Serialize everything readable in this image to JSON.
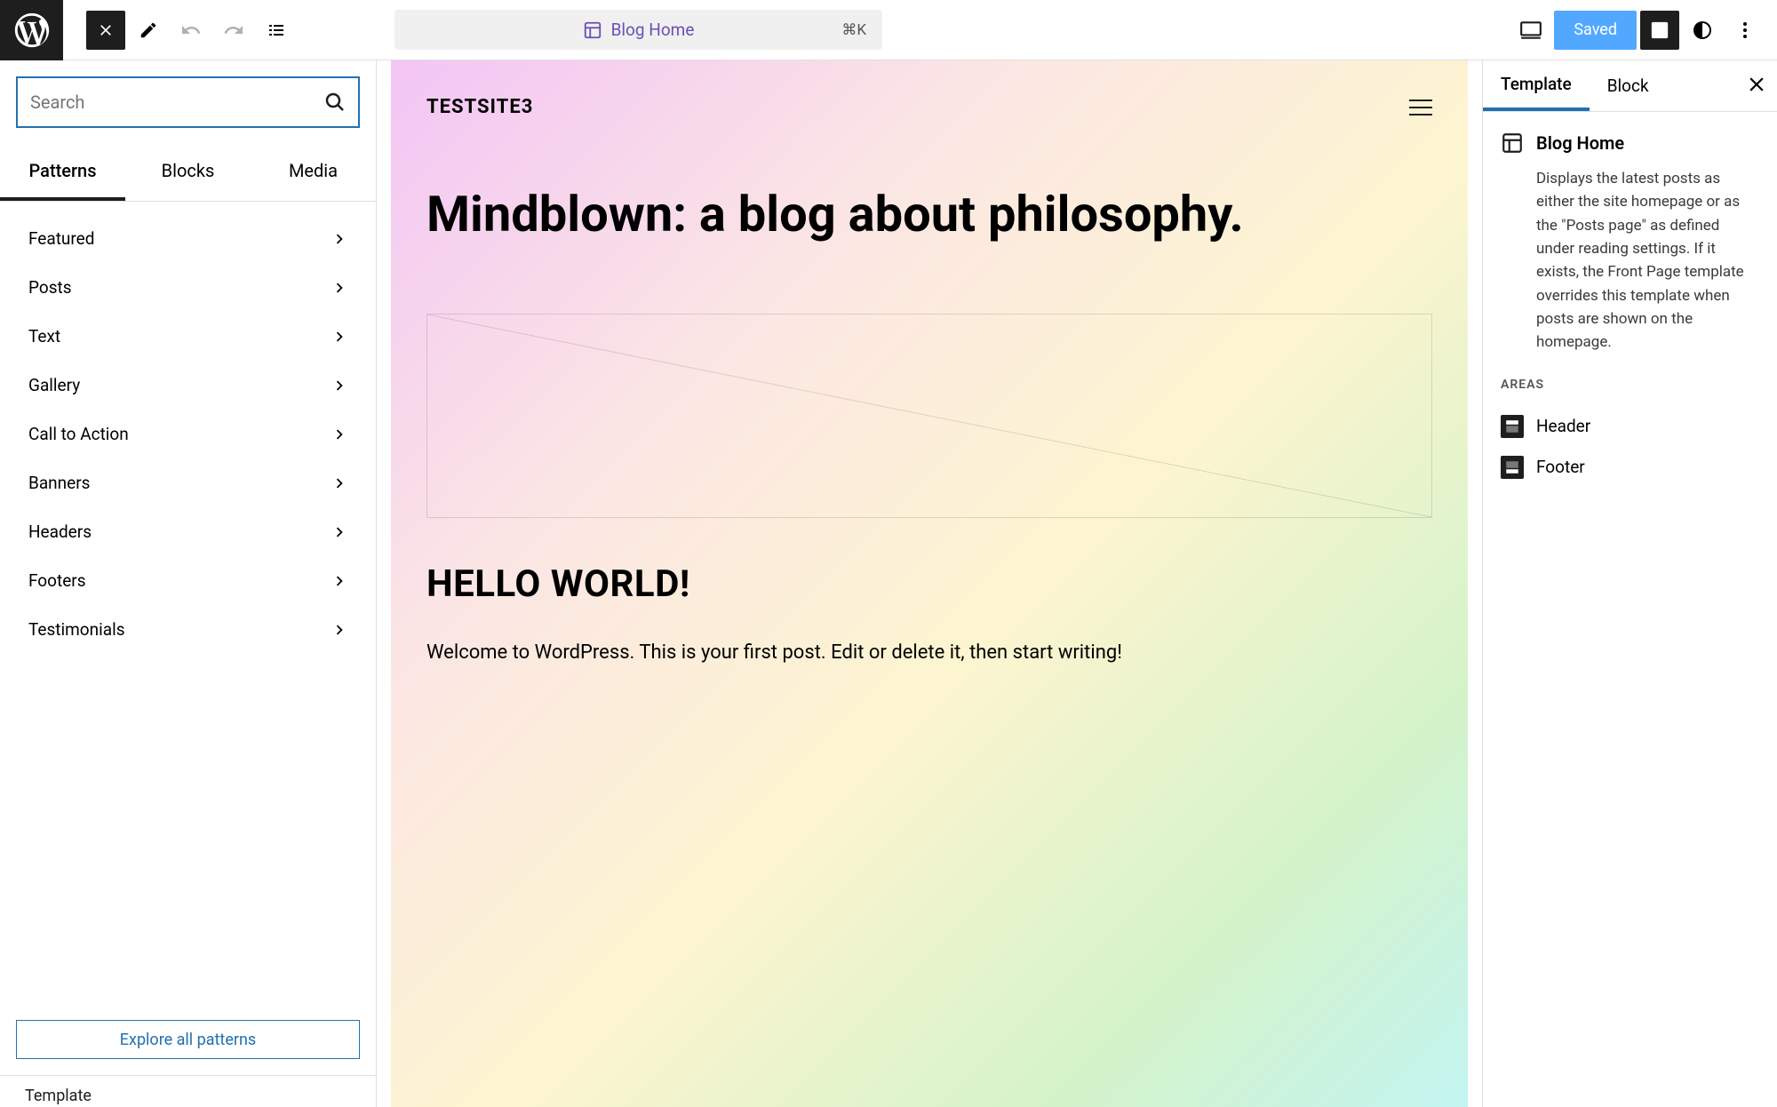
{
  "topbar": {
    "doc_title": "Blog Home",
    "shortcut": "⌘K",
    "saved_label": "Saved"
  },
  "left": {
    "search_placeholder": "Search",
    "tabs": {
      "patterns": "Patterns",
      "blocks": "Blocks",
      "media": "Media"
    },
    "active_tab": "patterns",
    "categories": [
      "Featured",
      "Posts",
      "Text",
      "Gallery",
      "Call to Action",
      "Banners",
      "Headers",
      "Footers",
      "Testimonials"
    ],
    "explore_label": "Explore all patterns",
    "bottom_label": "Template"
  },
  "canvas": {
    "site_name": "TESTSITE3",
    "hero_heading": "Mindblown: a blog about philosophy.",
    "post_title": "HELLO WORLD!",
    "post_body": "Welcome to WordPress. This is your first post. Edit or delete it, then start writing!"
  },
  "right": {
    "tabs": {
      "template": "Template",
      "block": "Block"
    },
    "active_tab": "template",
    "template_name": "Blog Home",
    "template_desc": "Displays the latest posts as either the site homepage or as the \"Posts page\" as defined under reading settings. If it exists, the Front Page template overrides this template when posts are shown on the homepage.",
    "areas_label": "AREAS",
    "areas": [
      "Header",
      "Footer"
    ]
  }
}
